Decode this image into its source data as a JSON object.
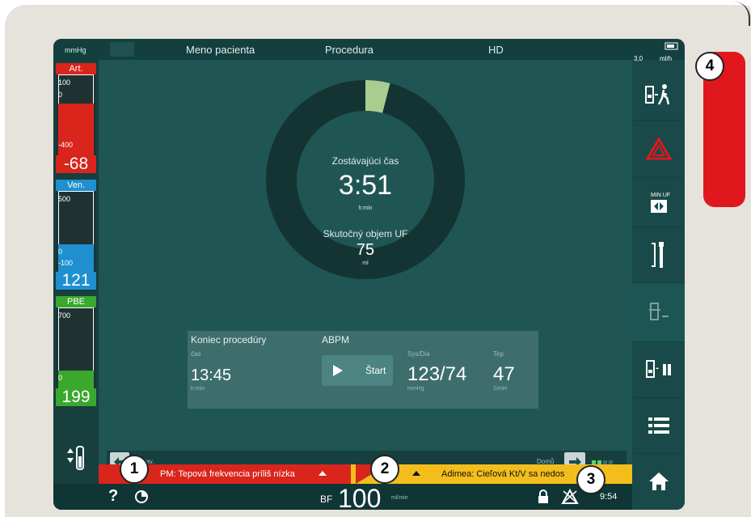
{
  "header": {
    "unit": "mmHg",
    "patient": "Meno pacienta",
    "procedure": "Procedura",
    "mode": "HD",
    "uf_rate": "3,0",
    "uf_unit": "ml/h"
  },
  "pressures": {
    "arterial": {
      "label": "Art.",
      "top": "100",
      "zero": "0",
      "bottom": "-400",
      "value": "-68"
    },
    "venous": {
      "label": "Ven.",
      "top": "500",
      "zero": "0",
      "bottom": "-100",
      "value": "121"
    },
    "pbe": {
      "label": "PBE",
      "top": "700",
      "bottom": "0",
      "value": "199"
    }
  },
  "ring": {
    "remaining_label": "Zostávajúci čas",
    "remaining_value": "3:51",
    "remaining_unit": "h:min",
    "uf_label": "Skutočný objem UF",
    "uf_value": "75",
    "uf_unit": "ml",
    "progress": 0.04
  },
  "info_panel": {
    "end_title": "Koniec procedúry",
    "time_label": "čas",
    "end_time": "13:45",
    "end_unit": "h:min",
    "abpm_title": "ABPM",
    "start_button": "Štart",
    "sysdia_label": "Sys/Dia",
    "sysdia_value": "123/74",
    "sysdia_unit": "mmHg",
    "pulse_label": "Tep",
    "pulse_value": "47",
    "pulse_unit": "1/min"
  },
  "nav": {
    "back": "Nastav.",
    "home": "Domů"
  },
  "alarms": {
    "left": "PM: Tepová frekvencia príliš nízka",
    "right": "Adimea: Cieľová Kt/V sa nedos"
  },
  "bottom": {
    "bf_label": "BF",
    "bf_value": "100",
    "bf_unit": "ml/min",
    "time": "9:54"
  },
  "callouts": [
    "1",
    "2",
    "3",
    "4"
  ],
  "colors": {
    "arterial": "#d9251c",
    "venous": "#1f8fd0",
    "pbe": "#3aa72d",
    "alarm_red": "#d9251c",
    "alarm_yellow": "#f3be1c",
    "screen_bg": "#1f5654",
    "indicator": "#e1171e"
  }
}
